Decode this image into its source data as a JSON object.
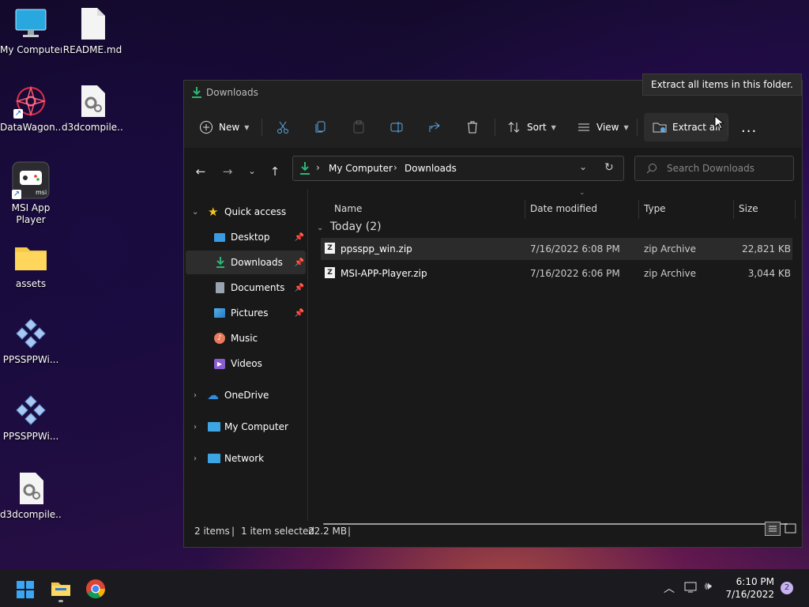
{
  "desktop": {
    "icons": [
      {
        "label": "My Computer",
        "icon": "monitor-icon"
      },
      {
        "label": "README.md",
        "icon": "file-icon"
      },
      {
        "label": "DataWagon...",
        "icon": "app-icon"
      },
      {
        "label": "d3dcompile...",
        "icon": "settings-file-icon"
      },
      {
        "label": "MSI App\nPlayer",
        "label_line1": "MSI App",
        "label_line2": "Player",
        "icon": "msi-app-icon"
      },
      {
        "label": "assets",
        "icon": "folder-icon"
      },
      {
        "label": "PPSSPPWi...",
        "icon": "ppsspp-icon"
      },
      {
        "label": "PPSSPPWi...",
        "icon": "ppsspp-icon"
      },
      {
        "label": "d3dcompile...",
        "icon": "settings-file-icon"
      }
    ]
  },
  "window": {
    "title": "Downloads",
    "toolbar": {
      "new_label": "New",
      "sort_label": "Sort",
      "view_label": "View",
      "extract_label": "Extract all",
      "more_label": "..."
    },
    "tooltip": "Extract all items in this folder.",
    "address": {
      "crumbs": [
        "My Computer",
        "Downloads"
      ]
    },
    "search": {
      "placeholder": "Search Downloads"
    },
    "sidebar": {
      "quick_access": "Quick access",
      "items": [
        {
          "label": "Desktop",
          "pinned": true
        },
        {
          "label": "Downloads",
          "pinned": true,
          "selected": true
        },
        {
          "label": "Documents",
          "pinned": true
        },
        {
          "label": "Pictures",
          "pinned": true
        },
        {
          "label": "Music"
        },
        {
          "label": "Videos"
        }
      ],
      "onedrive": "OneDrive",
      "my_computer": "My Computer",
      "network": "Network"
    },
    "columns": [
      "Name",
      "Date modified",
      "Type",
      "Size"
    ],
    "group": "Today (2)",
    "files": [
      {
        "name": "ppsspp_win.zip",
        "date": "7/16/2022 6:08 PM",
        "type": "zip Archive",
        "size": "22,821 KB",
        "selected": true
      },
      {
        "name": "MSI-APP-Player.zip",
        "date": "7/16/2022 6:06 PM",
        "type": "zip Archive",
        "size": "3,044 KB"
      }
    ],
    "status": {
      "items": "2 items",
      "selected": "1 item selected",
      "size": "22.2 MB"
    }
  },
  "taskbar": {
    "time": "6:10 PM",
    "date": "7/16/2022",
    "notifications": "2",
    "accent": "#0078d4"
  }
}
